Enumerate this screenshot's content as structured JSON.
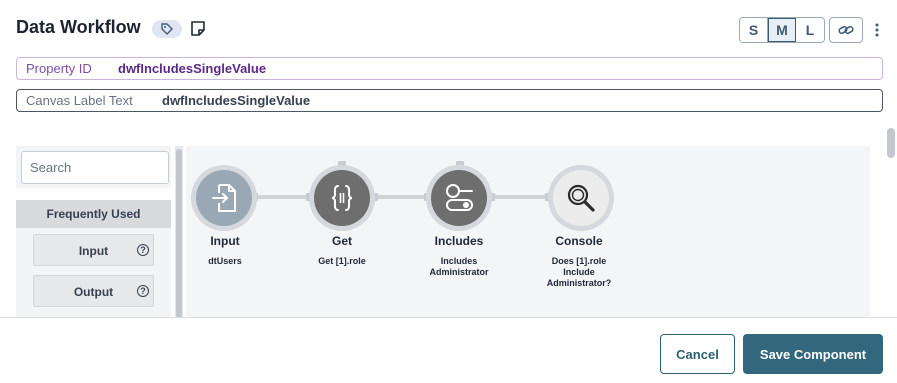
{
  "header": {
    "title": "Data Workflow",
    "sizes": [
      "S",
      "M",
      "L"
    ],
    "active_size": "M"
  },
  "fields": {
    "property_id": {
      "label": "Property ID",
      "value": "dwfIncludesSingleValue"
    },
    "canvas_label": {
      "label": "Canvas Label Text",
      "value": "dwfIncludesSingleValue"
    }
  },
  "palette": {
    "search_placeholder": "Search",
    "section": "Frequently Used",
    "items": [
      {
        "label": "Input",
        "help": "?"
      },
      {
        "label": "Output",
        "help": "?"
      }
    ]
  },
  "workflow": {
    "nodes": [
      {
        "label": "Input",
        "sub": [
          "dtUsers"
        ],
        "icon": "input-file-icon"
      },
      {
        "label": "Get",
        "sub": [
          "Get [1].role"
        ],
        "icon": "curly-braces-icon"
      },
      {
        "label": "Includes",
        "sub": [
          "Includes",
          "Administrator"
        ],
        "icon": "toggle-circles-icon"
      },
      {
        "label": "Console",
        "sub": [
          "Does [1].role",
          "Include",
          "Administrator?"
        ],
        "icon": "magnifier-icon"
      }
    ]
  },
  "footer": {
    "cancel": "Cancel",
    "save": "Save Component"
  },
  "colors": {
    "primary": "#33677d",
    "node_dark": "#6e6e6e",
    "node_light": "#ececec",
    "property_accent": "#7d4e9e"
  }
}
